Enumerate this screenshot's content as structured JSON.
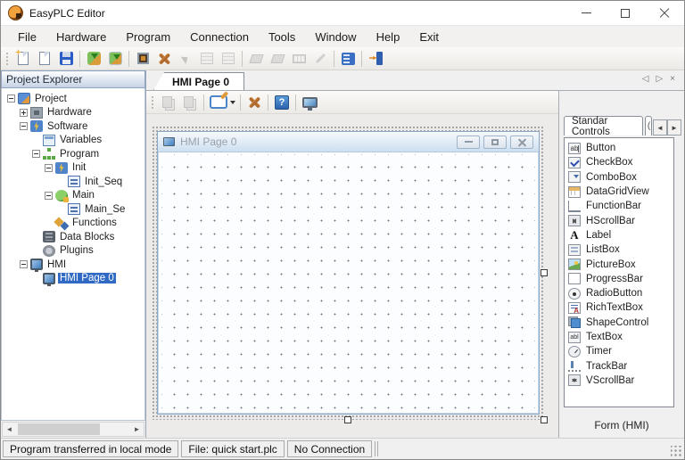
{
  "window": {
    "title": "EasyPLC Editor"
  },
  "menu": {
    "items": [
      "File",
      "Hardware",
      "Program",
      "Connection",
      "Tools",
      "Window",
      "Help",
      "Exit"
    ]
  },
  "project_explorer": {
    "title": "Project Explorer",
    "tree": [
      {
        "label": "Project",
        "level": 0,
        "expander": "minus",
        "icon": "project",
        "selected": false
      },
      {
        "label": "Hardware",
        "level": 1,
        "expander": "plus",
        "icon": "hardware",
        "selected": false
      },
      {
        "label": "Software",
        "level": 1,
        "expander": "minus",
        "icon": "bolt",
        "selected": false
      },
      {
        "label": "Variables",
        "level": 2,
        "expander": "none",
        "icon": "variables",
        "selected": false
      },
      {
        "label": "Program",
        "level": 2,
        "expander": "minus",
        "icon": "program",
        "selected": false
      },
      {
        "label": "Init",
        "level": 3,
        "expander": "minus",
        "icon": "bolt",
        "selected": false
      },
      {
        "label": "Init_Seq",
        "level": 4,
        "expander": "none",
        "icon": "seq",
        "selected": false
      },
      {
        "label": "Main",
        "level": 3,
        "expander": "minus",
        "icon": "main",
        "selected": false
      },
      {
        "label": "Main_Se",
        "level": 4,
        "expander": "none",
        "icon": "seq",
        "selected": false
      },
      {
        "label": "Functions",
        "level": 3,
        "expander": "none",
        "icon": "functions",
        "selected": false
      },
      {
        "label": "Data Blocks",
        "level": 2,
        "expander": "none",
        "icon": "datablocks",
        "selected": false
      },
      {
        "label": "Plugins",
        "level": 2,
        "expander": "none",
        "icon": "plugins",
        "selected": false
      },
      {
        "label": "HMI",
        "level": 1,
        "expander": "minus",
        "icon": "hmi",
        "selected": false
      },
      {
        "label": "HMI Page 0",
        "level": 2,
        "expander": "none",
        "icon": "hmi",
        "selected": true
      }
    ]
  },
  "document": {
    "tab_label": "HMI Page 0",
    "form_title": "HMI Page 0"
  },
  "toolbox": {
    "tab_label": "Standar Controls",
    "footer": "Form (HMI)",
    "items": [
      {
        "label": "Button",
        "icon": "button",
        "icon_text": "ab"
      },
      {
        "label": "CheckBox",
        "icon": "check",
        "icon_text": ""
      },
      {
        "label": "ComboBox",
        "icon": "combo",
        "icon_text": ""
      },
      {
        "label": "DataGridView",
        "icon": "dgv",
        "icon_text": ""
      },
      {
        "label": "FunctionBar",
        "icon": "funcbar",
        "icon_text": ""
      },
      {
        "label": "HScrollBar",
        "icon": "hscroll",
        "icon_text": ""
      },
      {
        "label": "Label",
        "icon": "label",
        "icon_text": "A"
      },
      {
        "label": "ListBox",
        "icon": "list",
        "icon_text": ""
      },
      {
        "label": "PictureBox",
        "icon": "picture",
        "icon_text": ""
      },
      {
        "label": "ProgressBar",
        "icon": "progress",
        "icon_text": ""
      },
      {
        "label": "RadioButton",
        "icon": "radio",
        "icon_text": ""
      },
      {
        "label": "RichTextBox",
        "icon": "rich",
        "icon_text": ""
      },
      {
        "label": "ShapeControl",
        "icon": "shape",
        "icon_text": ""
      },
      {
        "label": "TextBox",
        "icon": "text",
        "icon_text": "abl"
      },
      {
        "label": "Timer",
        "icon": "timer",
        "icon_text": ""
      },
      {
        "label": "TrackBar",
        "icon": "track",
        "icon_text": ""
      },
      {
        "label": "VScrollBar",
        "icon": "vscroll",
        "icon_text": ""
      }
    ]
  },
  "icons": {
    "help_glyph": "?",
    "tab_prev": "◁",
    "tab_next": "▷",
    "tab_close": "×",
    "scroll_left": "◄",
    "scroll_right": "►",
    "toolbox_prev": "◄",
    "toolbox_next": "►"
  },
  "status_bar": {
    "sections": [
      "Program transferred in local mode",
      "File: quick start.plc",
      "No Connection"
    ]
  },
  "colors": {
    "selection_blue": "#316ac5",
    "form_titlebar": "#cddff0",
    "canvas_gray": "#ecebe9",
    "delete_x_brown": "#b06a2e"
  }
}
